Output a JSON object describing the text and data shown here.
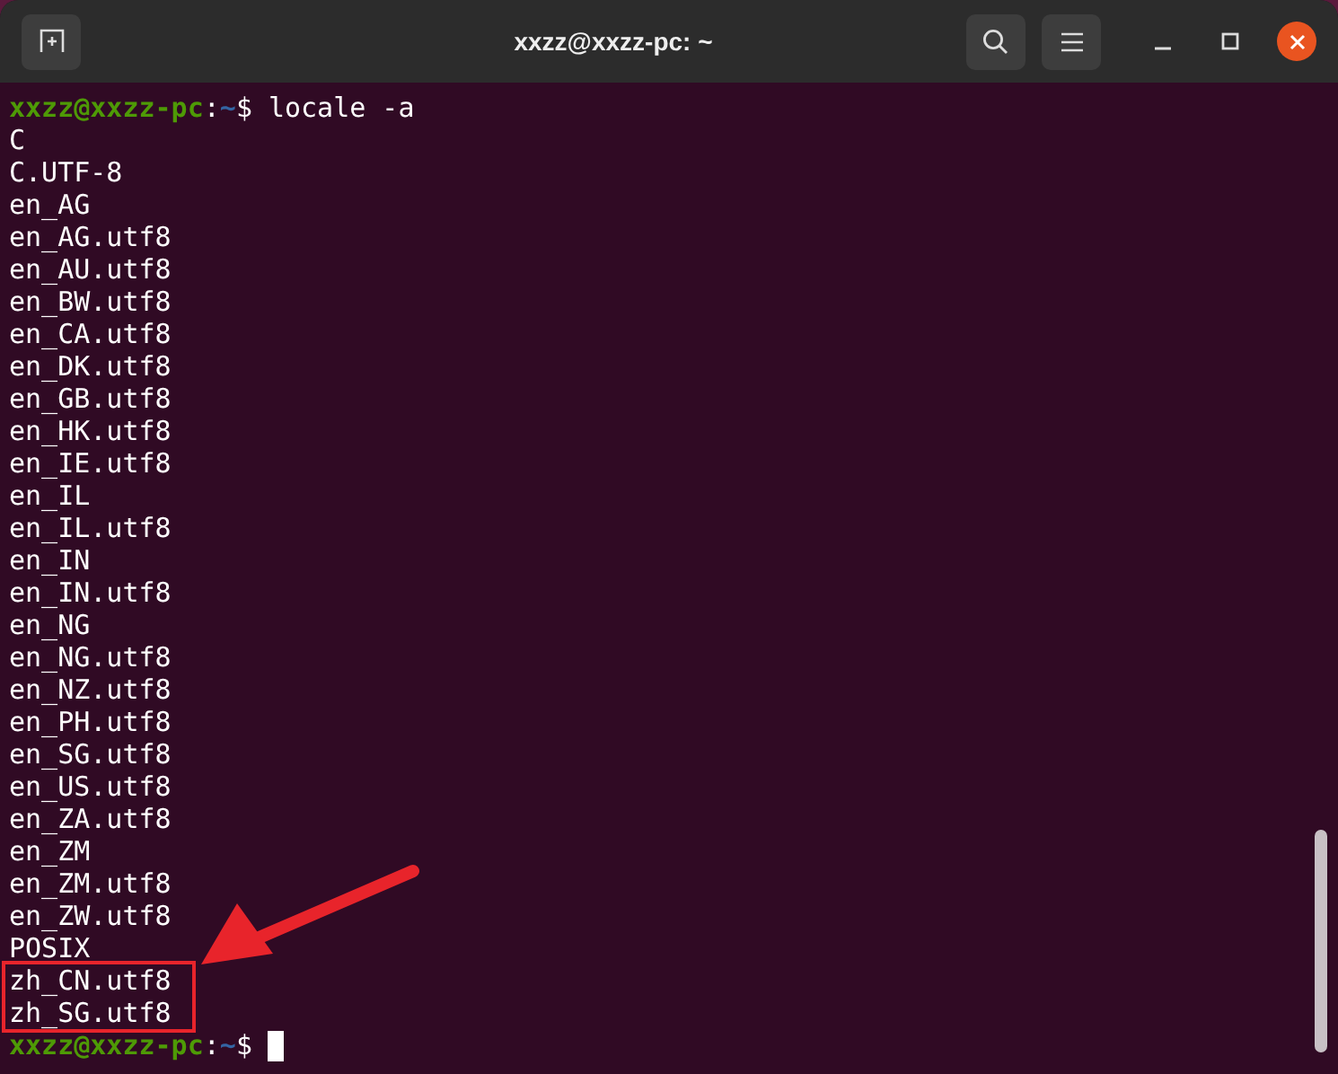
{
  "window": {
    "title": "xxzz@xxzz-pc: ~"
  },
  "lines": [
    {
      "kind": "prompt",
      "user_host": "xxzz@xxzz-pc",
      "colon": ":",
      "path": "~",
      "symbol": "$",
      "command": "locale -a",
      "cursor": false
    },
    {
      "kind": "output",
      "text": "C"
    },
    {
      "kind": "output",
      "text": "C.UTF-8"
    },
    {
      "kind": "output",
      "text": "en_AG"
    },
    {
      "kind": "output",
      "text": "en_AG.utf8"
    },
    {
      "kind": "output",
      "text": "en_AU.utf8"
    },
    {
      "kind": "output",
      "text": "en_BW.utf8"
    },
    {
      "kind": "output",
      "text": "en_CA.utf8"
    },
    {
      "kind": "output",
      "text": "en_DK.utf8"
    },
    {
      "kind": "output",
      "text": "en_GB.utf8"
    },
    {
      "kind": "output",
      "text": "en_HK.utf8"
    },
    {
      "kind": "output",
      "text": "en_IE.utf8"
    },
    {
      "kind": "output",
      "text": "en_IL"
    },
    {
      "kind": "output",
      "text": "en_IL.utf8"
    },
    {
      "kind": "output",
      "text": "en_IN"
    },
    {
      "kind": "output",
      "text": "en_IN.utf8"
    },
    {
      "kind": "output",
      "text": "en_NG"
    },
    {
      "kind": "output",
      "text": "en_NG.utf8"
    },
    {
      "kind": "output",
      "text": "en_NZ.utf8"
    },
    {
      "kind": "output",
      "text": "en_PH.utf8"
    },
    {
      "kind": "output",
      "text": "en_SG.utf8"
    },
    {
      "kind": "output",
      "text": "en_US.utf8"
    },
    {
      "kind": "output",
      "text": "en_ZA.utf8"
    },
    {
      "kind": "output",
      "text": "en_ZM"
    },
    {
      "kind": "output",
      "text": "en_ZM.utf8"
    },
    {
      "kind": "output",
      "text": "en_ZW.utf8"
    },
    {
      "kind": "output",
      "text": "POSIX"
    },
    {
      "kind": "highlight",
      "lines": [
        "zh_CN.utf8",
        "zh_SG.utf8"
      ]
    },
    {
      "kind": "prompt",
      "user_host": "xxzz@xxzz-pc",
      "colon": ":",
      "path": "~",
      "symbol": "$",
      "cursor": true
    }
  ]
}
